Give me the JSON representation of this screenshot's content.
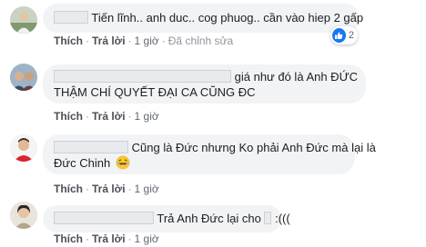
{
  "comments": [
    {
      "text_lines": [
        "Tiến lĩnh.. anh duc.. cog phuog.. cần vào hiep 2 gấp"
      ],
      "actions": [
        "Thích",
        "Trả lời",
        "1 giờ",
        "Đã chỉnh sửa"
      ],
      "reactions": {
        "icon": "like-icon",
        "count": "2"
      }
    },
    {
      "text_lines": [
        "giá như đó là Anh ĐỨC",
        "THẬM CHÍ QUYẾT ĐẠI CA CŨNG ĐC"
      ],
      "actions": [
        "Thích",
        "Trả lời",
        "1 giờ"
      ]
    },
    {
      "text_lines": [
        "Cũng là Đức nhưng Ko phải Anh Đức mà lại là",
        "Đức Chinh"
      ],
      "emoji": "laughing-emoji",
      "actions": [
        "Thích",
        "Trả lời",
        "1 giờ"
      ]
    },
    {
      "text_lines": [
        "Trả Anh Đức lại cho",
        ":((("
      ],
      "actions": [
        "Thích",
        "Trả lời",
        "1 giờ"
      ]
    }
  ],
  "colors": {
    "bubble": "#f2f3f5",
    "action_link": "#4b4f56",
    "like_blue": "#1877f2"
  }
}
